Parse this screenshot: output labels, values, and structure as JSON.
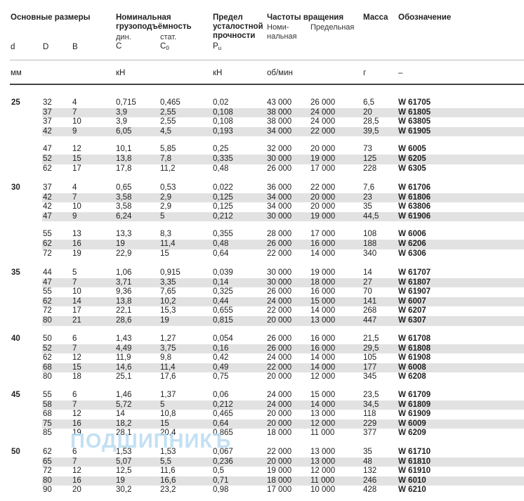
{
  "header": {
    "main_dims": "Основные размеры",
    "d": "d",
    "D": "D",
    "B": "B",
    "load_title_1": "Номинальная",
    "load_title_2": "грузоподъёмность",
    "dyn": "дин.",
    "stat": "стат.",
    "C": "C",
    "C0_main": "C",
    "C0_sub": "0",
    "fatigue_1": "Предел",
    "fatigue_2": "усталостной",
    "fatigue_3": "прочности",
    "Pu_main": "P",
    "Pu_sub": "u",
    "speed_title": "Частоты вращения",
    "speed_nom_1": "Номи-",
    "speed_nom_2": "нальная",
    "speed_limit": "Предельная",
    "mass": "Масса",
    "designation": "Обозначение"
  },
  "units": {
    "mm": "мм",
    "kn": "кН",
    "kn2": "кН",
    "rpm": "об/мин",
    "g": "г",
    "dash": "–"
  },
  "watermark": "ПОДШИПНИКЪ",
  "groups": [
    {
      "d": "25",
      "rows": [
        {
          "D": "32",
          "B": "4",
          "C": "0,715",
          "C0": "0,465",
          "Pu": "0,02",
          "n_ref": "43 000",
          "n_lim": "26 000",
          "m": "6,5",
          "des": "W 61705"
        },
        {
          "D": "37",
          "B": "7",
          "C": "3,9",
          "C0": "2,55",
          "Pu": "0,108",
          "n_ref": "38 000",
          "n_lim": "24 000",
          "m": "20",
          "des": "W 61805"
        },
        {
          "D": "37",
          "B": "10",
          "C": "3,9",
          "C0": "2,55",
          "Pu": "0,108",
          "n_ref": "38 000",
          "n_lim": "24 000",
          "m": "28,5",
          "des": "W 63805"
        },
        {
          "D": "42",
          "B": "9",
          "C": "6,05",
          "C0": "4,5",
          "Pu": "0,193",
          "n_ref": "34 000",
          "n_lim": "22 000",
          "m": "39,5",
          "des": "W 61905"
        },
        {
          "D": "47",
          "B": "12",
          "C": "10,1",
          "C0": "5,85",
          "Pu": "0,25",
          "n_ref": "32 000",
          "n_lim": "20 000",
          "m": "73",
          "des": "W 6005"
        },
        {
          "D": "52",
          "B": "15",
          "C": "13,8",
          "C0": "7,8",
          "Pu": "0,335",
          "n_ref": "30 000",
          "n_lim": "19 000",
          "m": "125",
          "des": "W 6205"
        },
        {
          "D": "62",
          "B": "17",
          "C": "17,8",
          "C0": "11,2",
          "Pu": "0,48",
          "n_ref": "26 000",
          "n_lim": "17 000",
          "m": "228",
          "des": "W 6305"
        }
      ]
    },
    {
      "d": "30",
      "rows": [
        {
          "D": "37",
          "B": "4",
          "C": "0,65",
          "C0": "0,53",
          "Pu": "0,022",
          "n_ref": "36 000",
          "n_lim": "22 000",
          "m": "7,6",
          "des": "W 61706"
        },
        {
          "D": "42",
          "B": "7",
          "C": "3,58",
          "C0": "2,9",
          "Pu": "0,125",
          "n_ref": "34 000",
          "n_lim": "20 000",
          "m": "23",
          "des": "W 61806"
        },
        {
          "D": "42",
          "B": "10",
          "C": "3,58",
          "C0": "2,9",
          "Pu": "0,125",
          "n_ref": "34 000",
          "n_lim": "20 000",
          "m": "35",
          "des": "W 63806"
        },
        {
          "D": "47",
          "B": "9",
          "C": "6,24",
          "C0": "5",
          "Pu": "0,212",
          "n_ref": "30 000",
          "n_lim": "19 000",
          "m": "44,5",
          "des": "W 61906"
        },
        {
          "D": "55",
          "B": "13",
          "C": "13,3",
          "C0": "8,3",
          "Pu": "0,355",
          "n_ref": "28 000",
          "n_lim": "17 000",
          "m": "108",
          "des": "W 6006"
        },
        {
          "D": "62",
          "B": "16",
          "C": "19",
          "C0": "11,4",
          "Pu": "0,48",
          "n_ref": "26 000",
          "n_lim": "16 000",
          "m": "188",
          "des": "W 6206"
        },
        {
          "D": "72",
          "B": "19",
          "C": "22,9",
          "C0": "15",
          "Pu": "0,64",
          "n_ref": "22 000",
          "n_lim": "14 000",
          "m": "340",
          "des": "W 6306"
        }
      ]
    },
    {
      "d": "35",
      "rows": [
        {
          "D": "44",
          "B": "5",
          "C": "1,06",
          "C0": "0,915",
          "Pu": "0,039",
          "n_ref": "30 000",
          "n_lim": "19 000",
          "m": "14",
          "des": "W 61707"
        },
        {
          "D": "47",
          "B": "7",
          "C": "3,71",
          "C0": "3,35",
          "Pu": "0,14",
          "n_ref": "30 000",
          "n_lim": "18 000",
          "m": "27",
          "des": "W 61807"
        },
        {
          "D": "55",
          "B": "10",
          "C": "9,36",
          "C0": "7,65",
          "Pu": "0,325",
          "n_ref": "26 000",
          "n_lim": "16 000",
          "m": "70",
          "des": "W 61907"
        },
        {
          "D": "62",
          "B": "14",
          "C": "13,8",
          "C0": "10,2",
          "Pu": "0,44",
          "n_ref": "24 000",
          "n_lim": "15 000",
          "m": "141",
          "des": "W 6007"
        },
        {
          "D": "72",
          "B": "17",
          "C": "22,1",
          "C0": "15,3",
          "Pu": "0,655",
          "n_ref": "22 000",
          "n_lim": "14 000",
          "m": "268",
          "des": "W 6207"
        },
        {
          "D": "80",
          "B": "21",
          "C": "28,6",
          "C0": "19",
          "Pu": "0,815",
          "n_ref": "20 000",
          "n_lim": "13 000",
          "m": "447",
          "des": "W 6307"
        }
      ]
    },
    {
      "d": "40",
      "rows": [
        {
          "D": "50",
          "B": "6",
          "C": "1,43",
          "C0": "1,27",
          "Pu": "0,054",
          "n_ref": "26 000",
          "n_lim": "16 000",
          "m": "21,5",
          "des": "W 61708"
        },
        {
          "D": "52",
          "B": "7",
          "C": "4,49",
          "C0": "3,75",
          "Pu": "0,16",
          "n_ref": "26 000",
          "n_lim": "16 000",
          "m": "29,5",
          "des": "W 61808"
        },
        {
          "D": "62",
          "B": "12",
          "C": "11,9",
          "C0": "9,8",
          "Pu": "0,42",
          "n_ref": "24 000",
          "n_lim": "14 000",
          "m": "105",
          "des": "W 61908"
        },
        {
          "D": "68",
          "B": "15",
          "C": "14,6",
          "C0": "11,4",
          "Pu": "0,49",
          "n_ref": "22 000",
          "n_lim": "14 000",
          "m": "177",
          "des": "W 6008"
        },
        {
          "D": "80",
          "B": "18",
          "C": "25,1",
          "C0": "17,6",
          "Pu": "0,75",
          "n_ref": "20 000",
          "n_lim": "12 000",
          "m": "345",
          "des": "W 6208"
        }
      ]
    },
    {
      "d": "45",
      "rows": [
        {
          "D": "55",
          "B": "6",
          "C": "1,46",
          "C0": "1,37",
          "Pu": "0,06",
          "n_ref": "24 000",
          "n_lim": "15 000",
          "m": "23,5",
          "des": "W 61709"
        },
        {
          "D": "58",
          "B": "7",
          "C": "5,72",
          "C0": "5",
          "Pu": "0,212",
          "n_ref": "24 000",
          "n_lim": "14 000",
          "m": "34,5",
          "des": "W 61809"
        },
        {
          "D": "68",
          "B": "12",
          "C": "14",
          "C0": "10,8",
          "Pu": "0,465",
          "n_ref": "20 000",
          "n_lim": "13 000",
          "m": "118",
          "des": "W 61909"
        },
        {
          "D": "75",
          "B": "16",
          "C": "18,2",
          "C0": "15",
          "Pu": "0,64",
          "n_ref": "20 000",
          "n_lim": "12 000",
          "m": "229",
          "des": "W 6009"
        },
        {
          "D": "85",
          "B": "19",
          "C": "28,1",
          "C0": "20,4",
          "Pu": "0,865",
          "n_ref": "18 000",
          "n_lim": "11 000",
          "m": "377",
          "des": "W 6209"
        }
      ]
    },
    {
      "d": "50",
      "rows": [
        {
          "D": "62",
          "B": "6",
          "C": "1,53",
          "C0": "1,53",
          "Pu": "0,067",
          "n_ref": "22 000",
          "n_lim": "13 000",
          "m": "35",
          "des": "W 61710"
        },
        {
          "D": "65",
          "B": "7",
          "C": "5,07",
          "C0": "5,5",
          "Pu": "0,236",
          "n_ref": "20 000",
          "n_lim": "13 000",
          "m": "48",
          "des": "W 61810"
        },
        {
          "D": "72",
          "B": "12",
          "C": "12,5",
          "C0": "11,6",
          "Pu": "0,5",
          "n_ref": "19 000",
          "n_lim": "12 000",
          "m": "132",
          "des": "W 61910"
        },
        {
          "D": "80",
          "B": "16",
          "C": "19",
          "C0": "16,6",
          "Pu": "0,71",
          "n_ref": "18 000",
          "n_lim": "11 000",
          "m": "246",
          "des": "W 6010"
        },
        {
          "D": "90",
          "B": "20",
          "C": "30,2",
          "C0": "23,2",
          "Pu": "0,98",
          "n_ref": "17 000",
          "n_lim": "10 000",
          "m": "428",
          "des": "W 6210"
        }
      ]
    }
  ]
}
